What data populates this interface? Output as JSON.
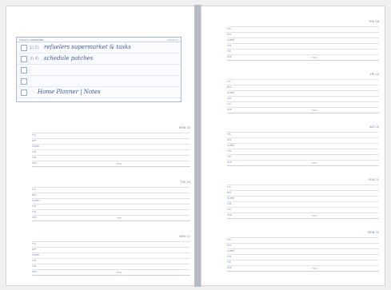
{
  "viewer": {
    "todo": {
      "title": "TODAY'S PRIORITIES",
      "tag": "PRIORITY",
      "rows": [
        {
          "num": "1) 2)",
          "text": "refuelers supermarket & tasks"
        },
        {
          "num": "3) 4)",
          "text": "schedule patches"
        },
        {
          "num": "",
          "text": ""
        },
        {
          "num": "",
          "text": ""
        },
        {
          "num": "",
          "text": "Home Planner | Notes"
        }
      ]
    },
    "left_page": {
      "blocks": [
        {
          "day": "MON 15",
          "labels": [
            "F/S",
            "RFT",
            "SLEEP",
            "C/B",
            "T/R",
            "W/E"
          ],
          "total": "TOT"
        },
        {
          "day": "TUE 16",
          "labels": [
            "F/S",
            "RFT",
            "SLEEP",
            "C/B",
            "T/R",
            "W/E"
          ],
          "total": "TOT"
        },
        {
          "day": "WED 17",
          "labels": [
            "F/S",
            "RFT",
            "SLEEP",
            "C/B",
            "T/R",
            "W/E"
          ],
          "total": "TOT"
        }
      ]
    },
    "right_page": {
      "blocks": [
        {
          "day": "THU 18",
          "labels": [
            "F/S",
            "RFT",
            "SLEEP",
            "C/B",
            "T/R",
            "W/E"
          ],
          "total": "TOT"
        },
        {
          "day": "FRI 19",
          "labels": [
            "F/S",
            "RFT",
            "SLEEP",
            "C/B",
            "T/R",
            "W/E"
          ],
          "total": "TOT"
        },
        {
          "day": "SAT 20",
          "labels": [
            "F/S",
            "RFT",
            "SLEEP",
            "C/B",
            "T/R",
            "W/E"
          ],
          "total": "TOT"
        },
        {
          "day": "SUN 21",
          "labels": [
            "F/S",
            "RFT",
            "SLEEP",
            "C/B",
            "T/R",
            "W/E"
          ],
          "total": "TOT"
        },
        {
          "day": "MON 22",
          "labels": [
            "F/S",
            "RFT",
            "SLEEP",
            "C/B",
            "T/R",
            "W/E"
          ],
          "total": "TOT"
        }
      ]
    }
  }
}
